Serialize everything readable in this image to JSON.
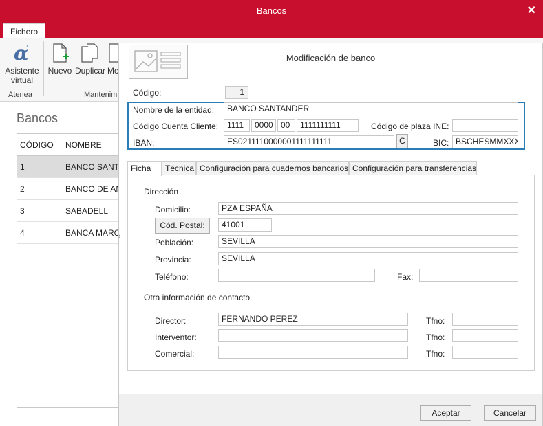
{
  "window": {
    "title": "Bancos",
    "close_glyph": "✕"
  },
  "ribbon": {
    "tab_label": "Fichero",
    "asistente_label": "Asistente virtual",
    "asistente_line1": "Asistente",
    "asistente_line2": "virtual",
    "nuevo_label": "Nuevo",
    "duplicar_label": "Duplicar",
    "mo_label": "Mo",
    "group_atenea": "Atenea",
    "group_mantenim": "Mantenim"
  },
  "list": {
    "title": "Bancos",
    "columns": {
      "code": "CÓDIGO",
      "name": "NOMBRE"
    },
    "rows": [
      {
        "code": "1",
        "name": "BANCO SANTA"
      },
      {
        "code": "2",
        "name": "BANCO DE AN"
      },
      {
        "code": "3",
        "name": "SABADELL"
      },
      {
        "code": "4",
        "name": "BANCA MARC"
      }
    ]
  },
  "modal": {
    "title": "Modificación de banco",
    "codigo_label": "Código:",
    "codigo_value": "1",
    "entidad_label": "Nombre de la entidad:",
    "entidad_value": "BANCO SANTANDER",
    "ccc_label": "Código Cuenta Cliente:",
    "ccc": {
      "entidad": "1111",
      "oficina": "0000",
      "dc": "00",
      "cuenta": "1111111111"
    },
    "plaza_label": "Código de plaza INE:",
    "plaza_value": "",
    "iban_label": "IBAN:",
    "iban_value": "ES0211110000001111111111",
    "iban_btn": "C",
    "bic_label": "BIC:",
    "bic_value": "BSCHESMMXXX",
    "tabs": [
      "Ficha",
      "Técnica",
      "Configuración para cuadernos bancarios",
      "Configuración para transferencias"
    ],
    "direccion": {
      "section": "Dirección",
      "domicilio_label": "Domicilio:",
      "domicilio_value": "PZA ESPAÑA",
      "cp_button": "Cód. Postal:",
      "cp_value": "41001",
      "poblacion_label": "Población:",
      "poblacion_value": "SEVILLA",
      "provincia_label": "Provincia:",
      "provincia_value": "SEVILLA",
      "telefono_label": "Teléfono:",
      "telefono_value": "",
      "fax_label": "Fax:",
      "fax_value": ""
    },
    "contacto": {
      "section": "Otra información de contacto",
      "director_label": "Director:",
      "director_value": "FERNANDO PEREZ",
      "interventor_label": "Interventor:",
      "interventor_value": "",
      "comercial_label": "Comercial:",
      "comercial_value": "",
      "tfno_label": "Tfno:",
      "tfno_director": "",
      "tfno_interventor": "",
      "tfno_comercial": ""
    },
    "accept": "Aceptar",
    "cancel": "Cancelar"
  },
  "colors": {
    "accent": "#c8102e",
    "highlight": "#2a7db5",
    "selected_row": "#dcdcdc"
  }
}
